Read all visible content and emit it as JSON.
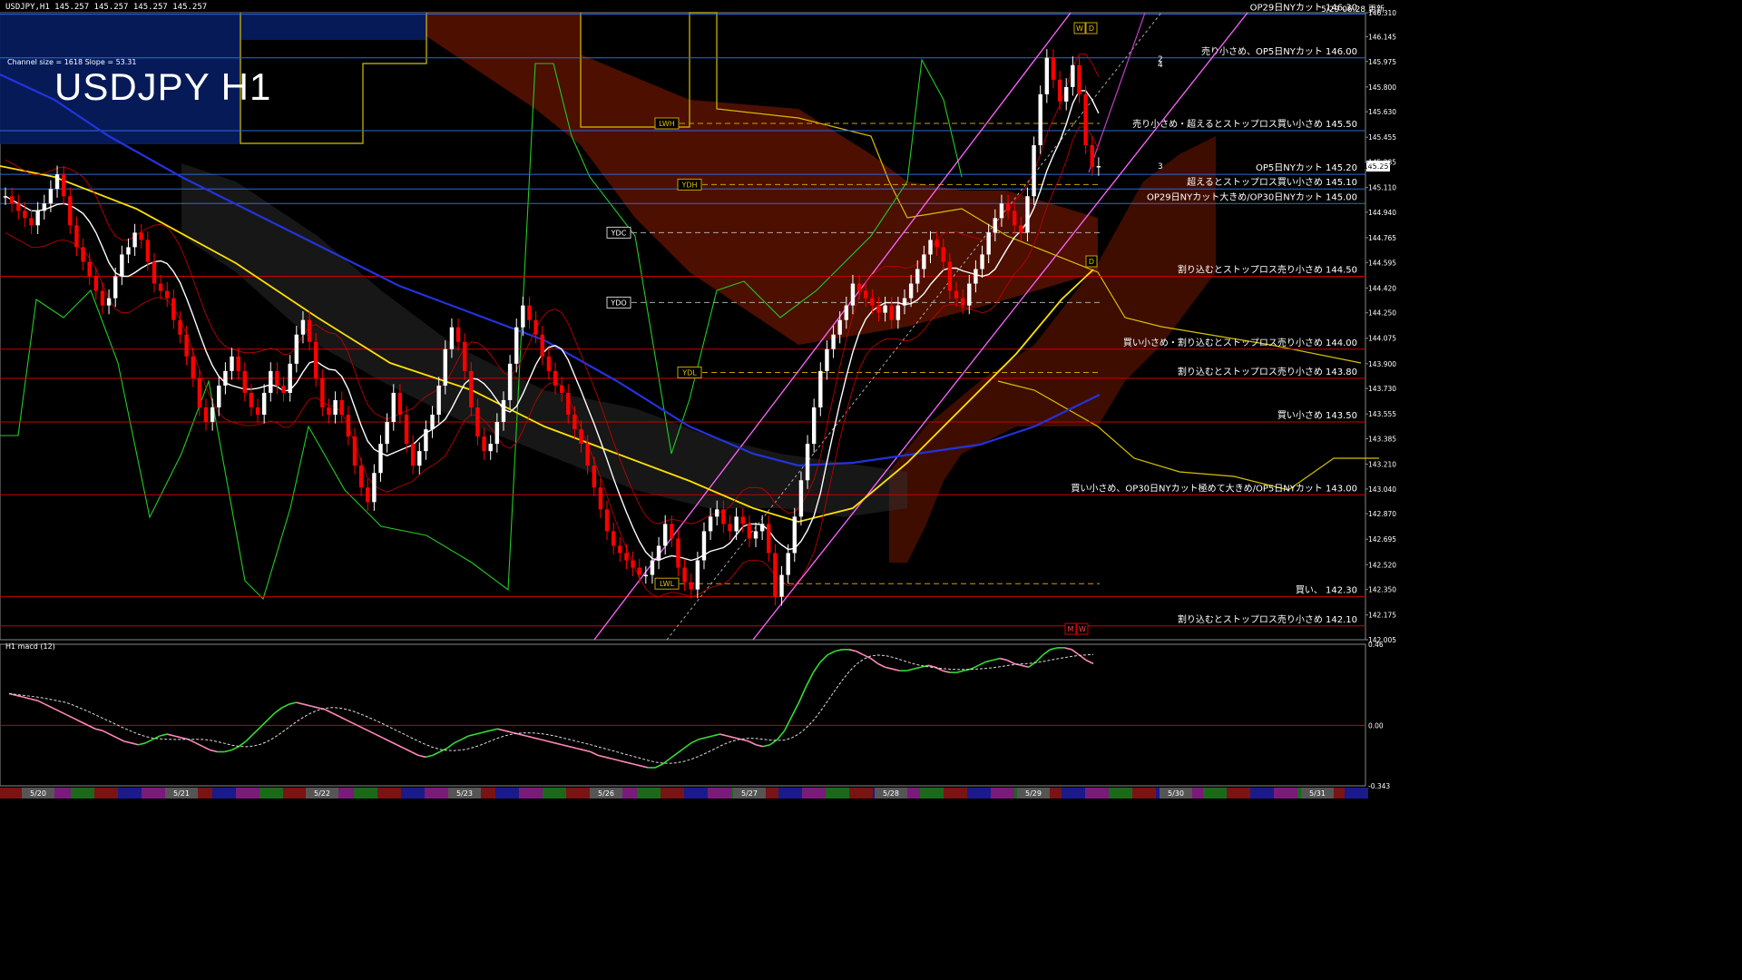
{
  "header": {
    "symbol_info": "USDJPY,H1  145.257 145.257 145.257 145.257",
    "timestamp": "5/29 06:28 更新",
    "channel_info": "Channel size = 1618 Slope = 53.31",
    "title": "USDJPY H1",
    "macd_label": "H1  macd (12)"
  },
  "colors": {
    "background": "#000000",
    "bull_candle": "#ffffff",
    "bear_candle": "#ff0000",
    "level_red": "#c80000",
    "level_blue": "#2a6ad8",
    "ma_white": "#ffffff",
    "ma_yellow": "#ffe000",
    "ma_blue": "#2233dd",
    "chikou_green": "#22cc22",
    "channel_pink": "#ff66ff",
    "cloud_bull": "#8a1c00",
    "ichimoku_line": "#d6c000"
  },
  "chart_data": {
    "type": "candlestick",
    "ylim": [
      142.005,
      146.31
    ],
    "y_ticks": [
      "146.310",
      "146.145",
      "145.975",
      "145.800",
      "145.630",
      "145.455",
      "145.285",
      "145.110",
      "144.940",
      "144.765",
      "144.595",
      "144.420",
      "144.250",
      "144.075",
      "143.900",
      "143.730",
      "143.555",
      "143.385",
      "143.210",
      "143.040",
      "142.870",
      "142.695",
      "142.520",
      "142.350",
      "142.175",
      "142.005"
    ],
    "current_price": "145.257",
    "x_dates": [
      "5/20",
      "5/21",
      "5/22",
      "5/23",
      "5/26",
      "5/27",
      "5/28",
      "5/29",
      "5/30",
      "5/31"
    ],
    "levels": [
      {
        "price": 146.3,
        "label": "OP29日NYカット 146.30",
        "color": "blue"
      },
      {
        "price": 146.0,
        "label": "売り小さめ、OP5日NYカット 146.00",
        "color": "blue"
      },
      {
        "price": 145.5,
        "label": "売り小さめ・超えるとストップロス買い小さめ 145.50",
        "color": "blue"
      },
      {
        "price": 145.2,
        "label": "OP5日NYカット 145.20",
        "color": "blue"
      },
      {
        "price": 145.1,
        "label": "超えるとストップロス買い小さめ 145.10",
        "color": "blue"
      },
      {
        "price": 145.0,
        "label": "OP29日NYカット大きめ/OP30日NYカット 145.00",
        "color": "blue"
      },
      {
        "price": 144.5,
        "label": "割り込むとストップロス売り小さめ 144.50",
        "color": "red"
      },
      {
        "price": 144.0,
        "label": "買い小さめ・割り込むとストップロス売り小さめ 144.00",
        "color": "red"
      },
      {
        "price": 143.8,
        "label": "割り込むとストップロス売り小さめ 143.80",
        "color": "red"
      },
      {
        "price": 143.5,
        "label": "買い小さめ 143.50",
        "color": "red"
      },
      {
        "price": 143.0,
        "label": "買い小さめ、OP30日NYカット極めて大きめ/OP5日NYカット 143.00",
        "color": "red"
      },
      {
        "price": 142.3,
        "label": "買い、 142.30",
        "color": "red"
      },
      {
        "price": 142.1,
        "label": "割り込むとストップロス売り小さめ 142.10",
        "color": "red"
      }
    ],
    "markers": [
      {
        "label": "LWH",
        "price": 145.55
      },
      {
        "label": "YDH",
        "price": 145.13
      },
      {
        "label": "YDC",
        "price": 144.8
      },
      {
        "label": "YDO",
        "price": 144.32
      },
      {
        "label": "YDL",
        "price": 143.84
      },
      {
        "label": "LWL",
        "price": 142.39
      }
    ],
    "corner_tags": [
      "W",
      "D",
      "D",
      "M",
      "W"
    ],
    "fib_labels": [
      "2",
      "4",
      "3"
    ],
    "closes": [
      145.05,
      145.0,
      144.95,
      144.9,
      144.85,
      144.95,
      145.0,
      145.1,
      145.2,
      145.05,
      144.85,
      144.7,
      144.6,
      144.5,
      144.4,
      144.3,
      144.35,
      144.5,
      144.65,
      144.7,
      144.8,
      144.75,
      144.6,
      144.45,
      144.4,
      144.35,
      144.2,
      144.1,
      143.95,
      143.8,
      143.6,
      143.5,
      143.6,
      143.75,
      143.85,
      143.95,
      143.85,
      143.7,
      143.6,
      143.55,
      143.7,
      143.85,
      143.75,
      143.7,
      143.9,
      144.1,
      144.2,
      144.05,
      143.8,
      143.6,
      143.55,
      143.65,
      143.55,
      143.4,
      143.2,
      143.05,
      142.95,
      143.15,
      143.35,
      143.5,
      143.7,
      143.55,
      143.35,
      143.2,
      143.3,
      143.45,
      143.55,
      143.75,
      144.0,
      144.15,
      144.05,
      143.85,
      143.6,
      143.4,
      143.3,
      143.35,
      143.5,
      143.65,
      143.9,
      144.15,
      144.3,
      144.2,
      144.1,
      143.95,
      143.85,
      143.75,
      143.7,
      143.55,
      143.45,
      143.35,
      143.2,
      143.05,
      142.9,
      142.75,
      142.65,
      142.6,
      142.55,
      142.5,
      142.45,
      142.45,
      142.55,
      142.65,
      142.8,
      142.7,
      142.5,
      142.4,
      142.35,
      142.55,
      142.75,
      142.85,
      142.9,
      142.8,
      142.75,
      142.85,
      142.8,
      142.7,
      142.75,
      142.8,
      142.6,
      142.3,
      142.45,
      142.6,
      142.85,
      143.1,
      143.35,
      143.6,
      143.85,
      144.0,
      144.1,
      144.2,
      144.3,
      144.45,
      144.4,
      144.35,
      144.3,
      144.25,
      144.3,
      144.2,
      144.3,
      144.35,
      144.45,
      144.55,
      144.65,
      144.75,
      144.7,
      144.6,
      144.4,
      144.35,
      144.3,
      144.45,
      144.55,
      144.65,
      144.8,
      144.9,
      145.0,
      144.95,
      144.85,
      144.8,
      145.05,
      145.4,
      145.75,
      146.0,
      145.85,
      145.7,
      145.8,
      145.95,
      145.75,
      145.4,
      145.25,
      145.257
    ],
    "macd": [
      0.18,
      0.17,
      0.16,
      0.15,
      0.14,
      0.12,
      0.1,
      0.08,
      0.06,
      0.04,
      0.02,
      0.0,
      -0.02,
      -0.03,
      -0.05,
      -0.07,
      -0.09,
      -0.1,
      -0.11,
      -0.1,
      -0.08,
      -0.06,
      -0.05,
      -0.06,
      -0.07,
      -0.08,
      -0.1,
      -0.12,
      -0.14,
      -0.15,
      -0.15,
      -0.14,
      -0.12,
      -0.09,
      -0.05,
      -0.01,
      0.03,
      0.07,
      0.1,
      0.12,
      0.13,
      0.12,
      0.11,
      0.1,
      0.09,
      0.07,
      0.05,
      0.03,
      0.01,
      -0.01,
      -0.03,
      -0.05,
      -0.07,
      -0.09,
      -0.11,
      -0.13,
      -0.15,
      -0.17,
      -0.18,
      -0.17,
      -0.15,
      -0.13,
      -0.1,
      -0.08,
      -0.06,
      -0.05,
      -0.04,
      -0.03,
      -0.02,
      -0.03,
      -0.04,
      -0.05,
      -0.06,
      -0.07,
      -0.08,
      -0.09,
      -0.1,
      -0.11,
      -0.12,
      -0.13,
      -0.14,
      -0.15,
      -0.17,
      -0.18,
      -0.19,
      -0.2,
      -0.21,
      -0.22,
      -0.23,
      -0.24,
      -0.24,
      -0.22,
      -0.19,
      -0.16,
      -0.13,
      -0.1,
      -0.08,
      -0.07,
      -0.06,
      -0.05,
      -0.06,
      -0.07,
      -0.08,
      -0.09,
      -0.11,
      -0.12,
      -0.11,
      -0.08,
      -0.03,
      0.05,
      0.13,
      0.22,
      0.3,
      0.36,
      0.4,
      0.42,
      0.43,
      0.43,
      0.42,
      0.4,
      0.38,
      0.35,
      0.33,
      0.32,
      0.31,
      0.31,
      0.32,
      0.33,
      0.34,
      0.33,
      0.31,
      0.3,
      0.3,
      0.31,
      0.32,
      0.34,
      0.36,
      0.37,
      0.38,
      0.37,
      0.35,
      0.34,
      0.33,
      0.36,
      0.4,
      0.43,
      0.44,
      0.44,
      0.43,
      0.4,
      0.37,
      0.35
    ],
    "macd_ylim": [
      -0.343,
      0.46
    ],
    "macd_ticks": [
      "0.46",
      "0.00",
      "-0.343"
    ]
  }
}
